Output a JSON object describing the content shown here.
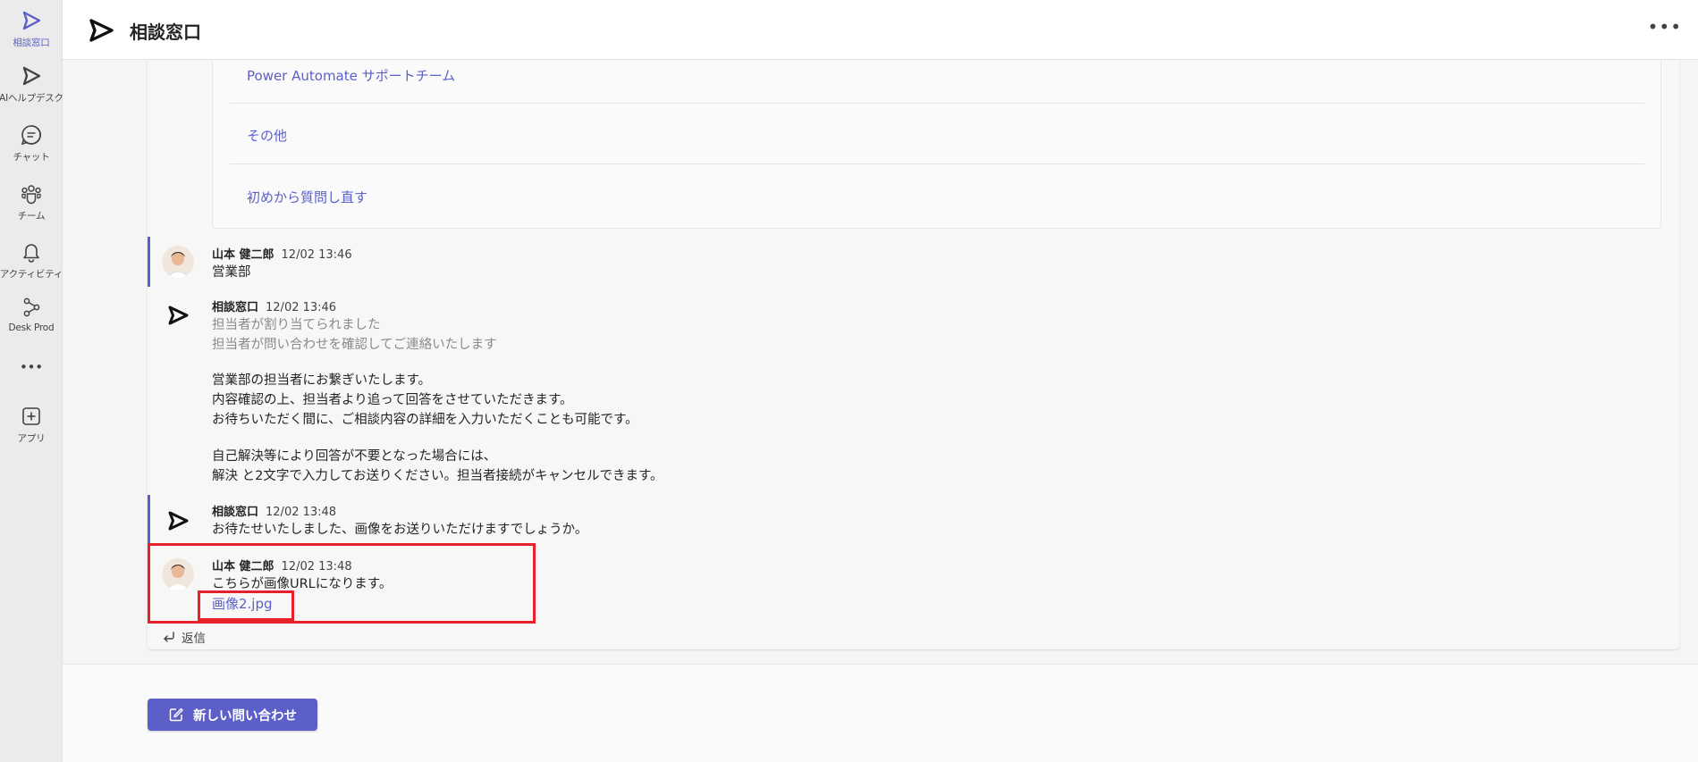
{
  "app": {
    "title": "相談窓口"
  },
  "rail": {
    "items": [
      {
        "label": "相談窓口",
        "icon": "send-arrow-icon"
      },
      {
        "label": "AIヘルプデスク",
        "icon": "send-arrow-icon"
      },
      {
        "label": "チャット",
        "icon": "chat-icon"
      },
      {
        "label": "チーム",
        "icon": "teams-icon"
      },
      {
        "label": "アクティビティ",
        "icon": "bell-icon"
      },
      {
        "label": "Desk Prod",
        "icon": "flow-icon"
      },
      {
        "label": "•••",
        "icon": "more-icon"
      },
      {
        "label": "アプリ",
        "icon": "add-apps-icon"
      }
    ]
  },
  "header": {
    "more": "•••"
  },
  "options": [
    "Power Automate サポートチーム",
    "その他",
    "初めから質問し直す"
  ],
  "messages": [
    {
      "name": "山本 健二郎",
      "time": "12/02 13:46",
      "lines": [
        "営業部"
      ]
    },
    {
      "name": "相談窓口",
      "time": "12/02 13:46",
      "grey_lines": [
        "担当者が割り当てられました",
        "担当者が問い合わせを確認してご連絡いたします"
      ],
      "para1": [
        "営業部の担当者にお繋ぎいたします。",
        "内容確認の上、担当者より追って回答をさせていただきます。",
        "お待ちいただく間に、ご相談内容の詳細を入力いただくことも可能です。"
      ],
      "para2": [
        "自己解決等により回答が不要となった場合には、",
        "解決 と2文字で入力してお送りください。担当者接続がキャンセルできます。"
      ]
    },
    {
      "name": "相談窓口",
      "time": "12/02 13:48",
      "lines": [
        "お待たせいたしました、画像をお送りいただけますでしょうか。"
      ]
    },
    {
      "name": "山本 健二郎",
      "time": "12/02 13:48",
      "lines": [
        "こちらが画像URLになります。"
      ],
      "link": "画像2.jpg"
    }
  ],
  "reply_label": "返信",
  "footer": {
    "new_inquiry": "新しい問い合わせ"
  },
  "colors": {
    "accent": "#5b5fc7",
    "highlight": "#e8202a"
  }
}
